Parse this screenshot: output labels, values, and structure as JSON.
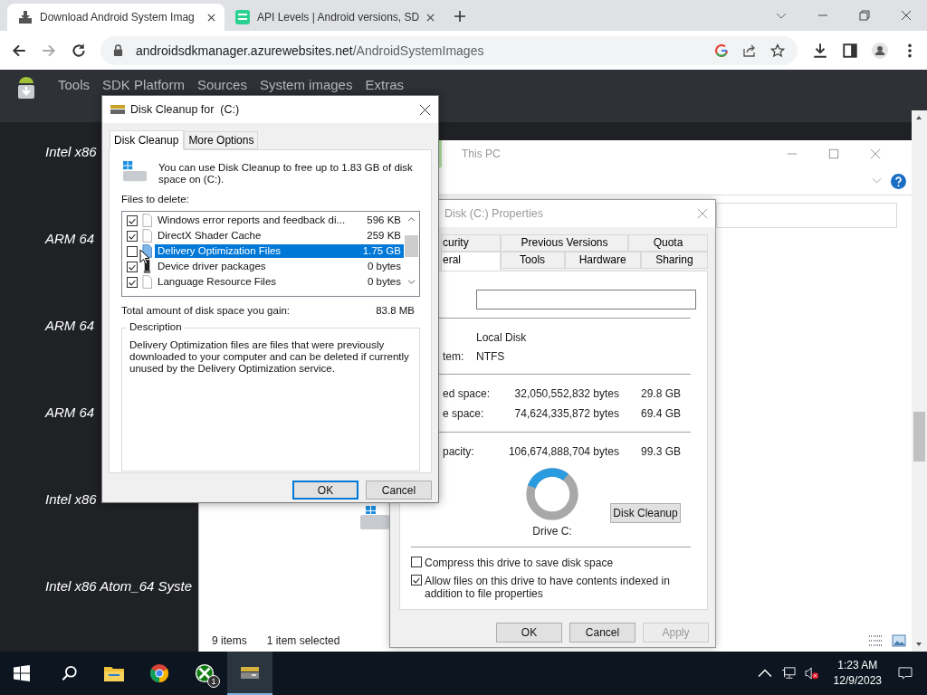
{
  "browser": {
    "tabs": [
      {
        "title": "Download Android System Imag",
        "kind": "download",
        "selected": true
      },
      {
        "title": "API Levels | Android versions, SD",
        "kind": "api",
        "selected": false
      }
    ],
    "url": {
      "domain": "androidsdkmanager.azurewebsites.net",
      "path": "/AndroidSystemImages"
    }
  },
  "site": {
    "nav": [
      "Tools",
      "SDK Platform",
      "Sources",
      "System images",
      "Extras"
    ],
    "items": [
      "Intel x86",
      "ARM 64",
      "ARM 64",
      "ARM 64",
      "Intel x86",
      "Intel x86 Atom_64 Syste"
    ]
  },
  "explorer": {
    "title": "This PC",
    "status": [
      "9 items",
      "1 item selected"
    ]
  },
  "properties": {
    "title": "Disk (C:) Properties",
    "tabs_top": [
      {
        "label": "curity",
        "selected": false
      },
      {
        "label": "Previous Versions",
        "selected": false
      },
      {
        "label": "Quota",
        "selected": false
      }
    ],
    "tabs_bottom": [
      {
        "label": "eral",
        "selected": true
      },
      {
        "label": "Tools",
        "selected": false
      },
      {
        "label": "Hardware",
        "selected": false
      },
      {
        "label": "Sharing",
        "selected": false
      }
    ],
    "type": "Local Disk",
    "fs_label": "tem:",
    "fs": "NTFS",
    "space": [
      {
        "label": "ed space:",
        "bytes": "32,050,552,832 bytes",
        "size": "29.8 GB"
      },
      {
        "label": "e space:",
        "bytes": "74,624,335,872 bytes",
        "size": "69.4 GB"
      }
    ],
    "capacity": {
      "label": "pacity:",
      "bytes": "106,674,888,704 bytes",
      "size": "99.3 GB"
    },
    "usage": {
      "level": 0.3
    },
    "drive_label": "Drive C:",
    "cleanup_button": "Disk Cleanup",
    "options": [
      {
        "label": "Compress this drive to save disk space",
        "checked": false
      },
      {
        "label": "Allow files on this drive to have contents indexed in addition to file properties",
        "checked": true
      }
    ],
    "buttons": [
      {
        "label": "OK",
        "disabled": false
      },
      {
        "label": "Cancel",
        "disabled": false
      },
      {
        "label": "Apply",
        "disabled": true
      }
    ]
  },
  "cleanup": {
    "title": "Disk Cleanup for  (C:)",
    "tabs": [
      {
        "label": "Disk Cleanup",
        "selected": true
      },
      {
        "label": "More Options",
        "selected": false
      }
    ],
    "intro": "You can use Disk Cleanup to free up to 1.83 GB of disk space on  (C:).",
    "files_label": "Files to delete:",
    "files": [
      {
        "name": "Windows error reports and feedback di...",
        "size": "596 KB",
        "checked": true,
        "kind": "page",
        "selected": false
      },
      {
        "name": "DirectX Shader Cache",
        "size": "259 KB",
        "checked": true,
        "kind": "page",
        "selected": false
      },
      {
        "name": "Delivery Optimization Files",
        "size": "1.75 GB",
        "checked": false,
        "kind": "blue-page",
        "selected": true
      },
      {
        "name": "Device driver packages",
        "size": "0 bytes",
        "checked": true,
        "kind": "tower",
        "selected": false
      },
      {
        "name": "Language Resource Files",
        "size": "0 bytes",
        "checked": true,
        "kind": "page",
        "selected": false
      }
    ],
    "total_label": "Total amount of disk space you gain:",
    "total": "83.8 MB",
    "description_label": "Description",
    "description": "Delivery Optimization files are files that were previously downloaded to your computer and can be deleted if currently unused by the Delivery Optimization service.",
    "buttons": [
      {
        "label": "OK",
        "default": true
      },
      {
        "label": "Cancel",
        "default": false
      }
    ]
  },
  "taskbar": {
    "apps": [
      {
        "kind": "explorer",
        "selected": false
      },
      {
        "kind": "chrome",
        "selected": false
      },
      {
        "kind": "xbox",
        "badge": "1",
        "selected": false
      },
      {
        "kind": "cleanup",
        "selected": true
      }
    ],
    "time": "1:23 AM",
    "date": "12/9/2023"
  }
}
